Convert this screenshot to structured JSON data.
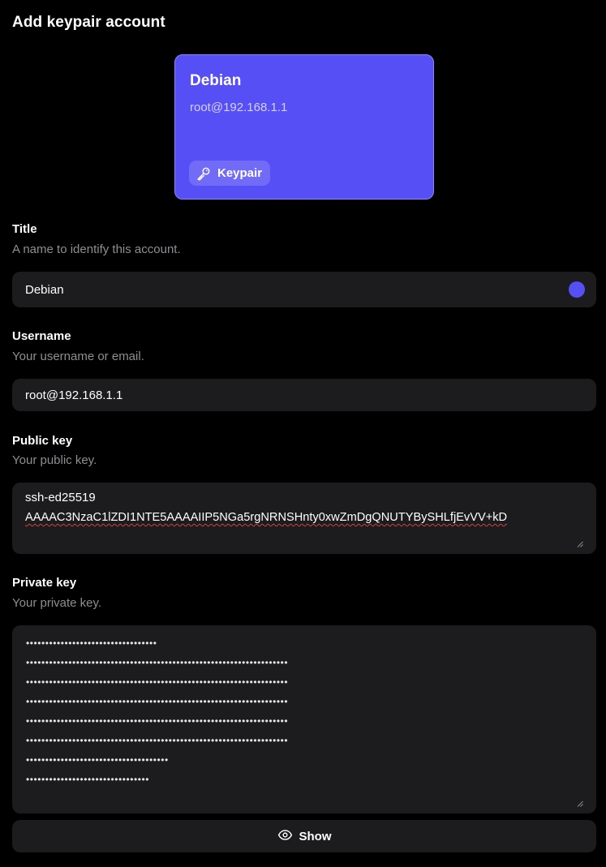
{
  "page": {
    "title": "Add keypair account"
  },
  "preview_card": {
    "title": "Debian",
    "subtitle": "root@192.168.1.1",
    "badge_label": "Keypair",
    "badge_icon": "key-icon",
    "color": "#574ff6"
  },
  "fields": {
    "title": {
      "label": "Title",
      "hint": "A name to identify this account.",
      "value": "Debian",
      "color_dot": "#574ff6"
    },
    "username": {
      "label": "Username",
      "hint": "Your username or email.",
      "value": "root@192.168.1.1"
    },
    "public_key": {
      "label": "Public key",
      "hint": "Your public key.",
      "line1": "ssh-ed25519",
      "line2": "AAAAC3NzaC1lZDI1NTE5AAAAIIP5NGa5rgNRNSHnty0xwZmDgQNUTYBySHLfjEvVV+kD"
    },
    "private_key": {
      "label": "Private key",
      "hint": "Your private key.",
      "masked_lines": [
        "••••••••••••••••••••••••••••••••••",
        "••••••••••••••••••••••••••••••••••••••••••••••••••••••••••••••••••••",
        "••••••••••••••••••••••••••••••••••••••••••••••••••••••••••••••••••••",
        "••••••••••••••••••••••••••••••••••••••••••••••••••••••••••••••••••••",
        "••••••••••••••••••••••••••••••••••••••••••••••••••••••••••••••••••••",
        "••••••••••••••••••••••••••••••••••••••••••••••••••••••••••••••••••••",
        "•••••••••••••••••••••••••••••••••••••",
        "••••••••••••••••••••••••••••••••"
      ]
    }
  },
  "show_button": {
    "label": "Show",
    "icon": "eye-icon"
  }
}
